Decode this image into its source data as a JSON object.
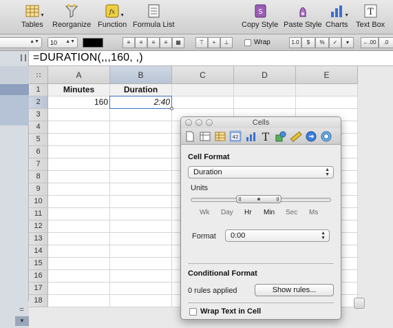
{
  "toolbar": {
    "items": [
      {
        "label": "Tables",
        "icon": "tables-icon"
      },
      {
        "label": "Reorganize",
        "icon": "reorganize-icon"
      },
      {
        "label": "Function",
        "icon": "function-icon"
      },
      {
        "label": "Formula List",
        "icon": "formula-list-icon"
      },
      {
        "label": "Copy Style",
        "icon": "copy-style-icon"
      },
      {
        "label": "Paste Style",
        "icon": "paste-style-icon"
      },
      {
        "label": "Charts",
        "icon": "charts-icon"
      },
      {
        "label": "Text Box",
        "icon": "text-box-icon"
      }
    ],
    "text_box_glyph": "T"
  },
  "format_bar": {
    "font_size": "10",
    "wrap_label": "Wrap",
    "format_buttons": [
      "1.0",
      "$",
      "%",
      "✓",
      "▾"
    ],
    "decimal_label": "←.00",
    "decimal_label2": ".0"
  },
  "formula": {
    "text": "=DURATION(,,,160, ,)"
  },
  "sheet": {
    "columns": [
      "A",
      "B",
      "C",
      "D",
      "E"
    ],
    "rows": [
      "1",
      "2",
      "3",
      "4",
      "5",
      "6",
      "7",
      "8",
      "9",
      "10",
      "11",
      "12",
      "13",
      "14",
      "15",
      "16",
      "17",
      "18"
    ],
    "header_a": "Minutes",
    "header_b": "Duration",
    "value_a2": "160",
    "value_b2": "2:40",
    "selected_cell": "B2"
  },
  "bottom": {
    "equals_glyph": "=",
    "arrow_glyph": "▼"
  },
  "inspector": {
    "title": "Cells",
    "icons": [
      "document-icon",
      "layout-icon",
      "table-icon",
      "cells-icon",
      "chart-icon",
      "text-icon",
      "shapes-icon",
      "ruler-icon",
      "link-icon",
      "quicktime-icon"
    ],
    "cells_icon_text": "42",
    "text_icon_glyph": "T",
    "cell_format_label": "Cell Format",
    "cell_format_value": "Duration",
    "units_label": "Units",
    "units": [
      "Wk",
      "Day",
      "Hr",
      "Min",
      "Sec",
      "Ms"
    ],
    "units_selected": [
      "Hr",
      "Min"
    ],
    "format_label": "Format",
    "format_value": "0:00",
    "conditional_format_label": "Conditional Format",
    "rules_applied": "0 rules applied",
    "show_rules_label": "Show rules...",
    "wrap_text_label": "Wrap Text in Cell",
    "wrap_text_checked": false
  }
}
